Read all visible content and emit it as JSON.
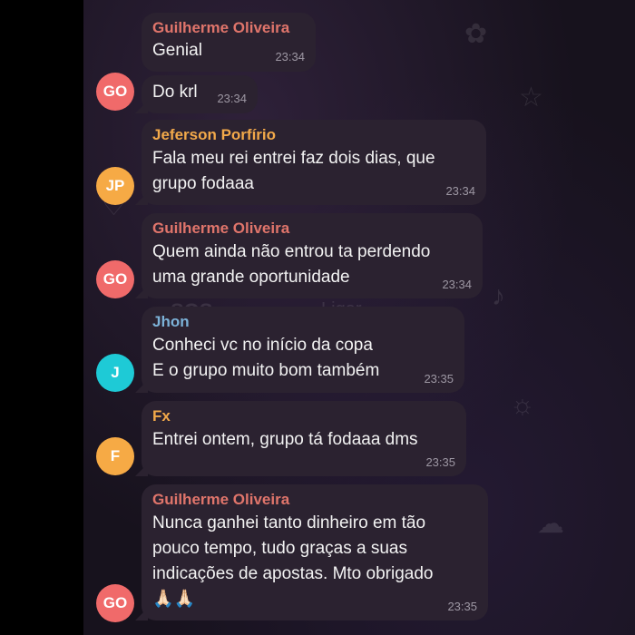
{
  "colors": {
    "name_red": "#e0756b",
    "name_orange": "#f2a94a",
    "name_blue": "#7cb2d8",
    "avatar_red": "#f06a6a",
    "avatar_orange": "#f6aa45",
    "avatar_cyan": "#1ecad6",
    "bubble_bg": "#2b2230",
    "chat_bg": "#17121d"
  },
  "background_overlay": {
    "ligar_label": "Ligar",
    "sos_label": "SOS"
  },
  "messages": [
    {
      "sender": "Guilherme Oliveira",
      "lines": [
        "Genial"
      ],
      "time": "23:34"
    },
    {
      "sender": "",
      "lines": [
        "Do krl"
      ],
      "time": "23:34",
      "avatar_initials": "GO"
    },
    {
      "sender": "Jeferson Porfírio",
      "lines": [
        "Fala meu rei entrei faz dois dias, que",
        "grupo fodaaa"
      ],
      "time": "23:34",
      "avatar_initials": "JP"
    },
    {
      "sender": "Guilherme Oliveira",
      "lines": [
        "Quem ainda não entrou ta perdendo",
        "uma grande oportunidade"
      ],
      "time": "23:34",
      "avatar_initials": "GO"
    },
    {
      "sender": "Jhon",
      "lines": [
        "Conheci vc no início da copa",
        "E o grupo muito bom também"
      ],
      "time": "23:35",
      "avatar_initials": "J"
    },
    {
      "sender": "Fx",
      "lines": [
        "Entrei ontem, grupo tá fodaaa dms"
      ],
      "time": "23:35",
      "avatar_initials": "F"
    },
    {
      "sender": "Guilherme Oliveira",
      "lines": [
        "Nunca ganhei tanto dinheiro em tão",
        "pouco tempo, tudo graças a suas",
        "indicações de apostas. Mto obrigado",
        "🙏🏻🙏🏻"
      ],
      "time": "23:35",
      "avatar_initials": "GO"
    }
  ]
}
